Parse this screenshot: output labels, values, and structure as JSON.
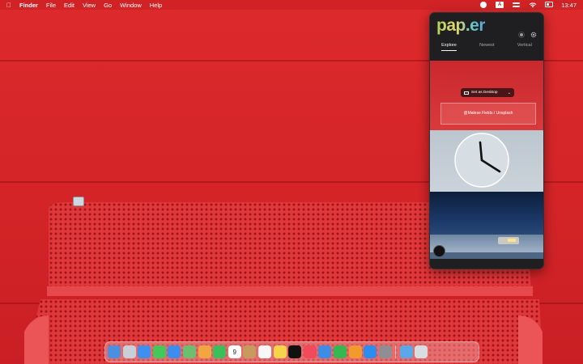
{
  "menubar": {
    "app_name": "Finder",
    "menus": [
      "File",
      "Edit",
      "View",
      "Go",
      "Window",
      "Help"
    ],
    "clock": "13:47",
    "input_source": "A"
  },
  "paper_app": {
    "logo": "pap.er",
    "tabs": [
      "Explore",
      "Newest",
      "Vertical"
    ],
    "active_tab": "Explore",
    "set_desktop_label": "Set as Desktop",
    "photo_credit": "@Malese Fields / Unsplash"
  },
  "dock": {
    "calendar_day": "9",
    "apps": [
      {
        "name": "finder-icon",
        "color": "#4a8fe0"
      },
      {
        "name": "launchpad-icon",
        "color": "#c9cfd6"
      },
      {
        "name": "safari-icon",
        "color": "#3d8ff0"
      },
      {
        "name": "messages-icon",
        "color": "#43c85a"
      },
      {
        "name": "mail-icon",
        "color": "#3a8ef0"
      },
      {
        "name": "maps-icon",
        "color": "#6bbf6f"
      },
      {
        "name": "photos-icon",
        "color": "#f2a641"
      },
      {
        "name": "facetime-icon",
        "color": "#3ac05a"
      },
      {
        "name": "calendar-icon",
        "color": "#ffffff"
      },
      {
        "name": "contacts-icon",
        "color": "#c79a5e"
      },
      {
        "name": "reminders-icon",
        "color": "#f7f7f7"
      },
      {
        "name": "notes-icon",
        "color": "#f5d34a"
      },
      {
        "name": "tv-icon",
        "color": "#111111"
      },
      {
        "name": "music-icon",
        "color": "#f24a5b"
      },
      {
        "name": "keynote-icon",
        "color": "#3b8de6"
      },
      {
        "name": "numbers-icon",
        "color": "#34b84f"
      },
      {
        "name": "pages-icon",
        "color": "#f29a2e"
      },
      {
        "name": "app-store-icon",
        "color": "#2d8cf0"
      },
      {
        "name": "system-preferences-icon",
        "color": "#8e8e93"
      }
    ],
    "trailing": [
      {
        "name": "downloads-folder-icon",
        "color": "#5aa8e8"
      },
      {
        "name": "trash-icon",
        "color": "#d8dde2"
      }
    ]
  }
}
